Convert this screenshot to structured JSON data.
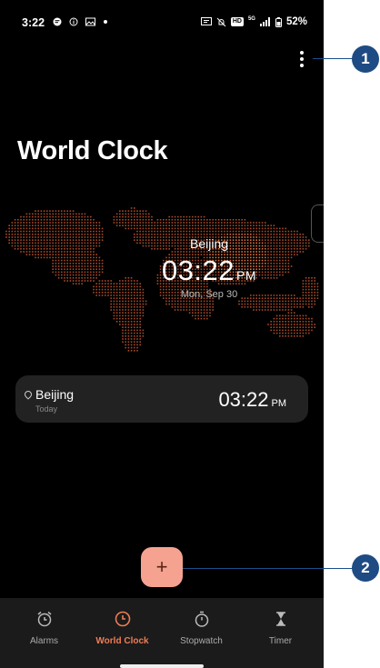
{
  "status_bar": {
    "time": "3:22",
    "battery": "52%",
    "network": "5G",
    "hd_badge": "HD"
  },
  "header": {
    "title": "World Clock",
    "more_menu_icon": "more-vertical-icon"
  },
  "map_clock": {
    "city": "Beijing",
    "time": "03:22",
    "ampm": "PM",
    "date": "Mon, Sep 30"
  },
  "clocks": [
    {
      "city": "Beijing",
      "day": "Today",
      "time": "03:22",
      "ampm": "PM"
    }
  ],
  "fab": {
    "label": "+"
  },
  "nav": {
    "items": [
      {
        "label": "Alarms",
        "icon": "alarm-icon"
      },
      {
        "label": "World Clock",
        "icon": "clock-icon"
      },
      {
        "label": "Stopwatch",
        "icon": "stopwatch-icon"
      },
      {
        "label": "Timer",
        "icon": "hourglass-icon"
      }
    ],
    "active": "World Clock"
  },
  "callouts": [
    "1",
    "2"
  ],
  "colors": {
    "accent": "#f07c55",
    "fab": "#f5a290",
    "map_dots": "#a64a2a",
    "map_highlight": "#e0703f",
    "callout": "#1e4b83"
  }
}
